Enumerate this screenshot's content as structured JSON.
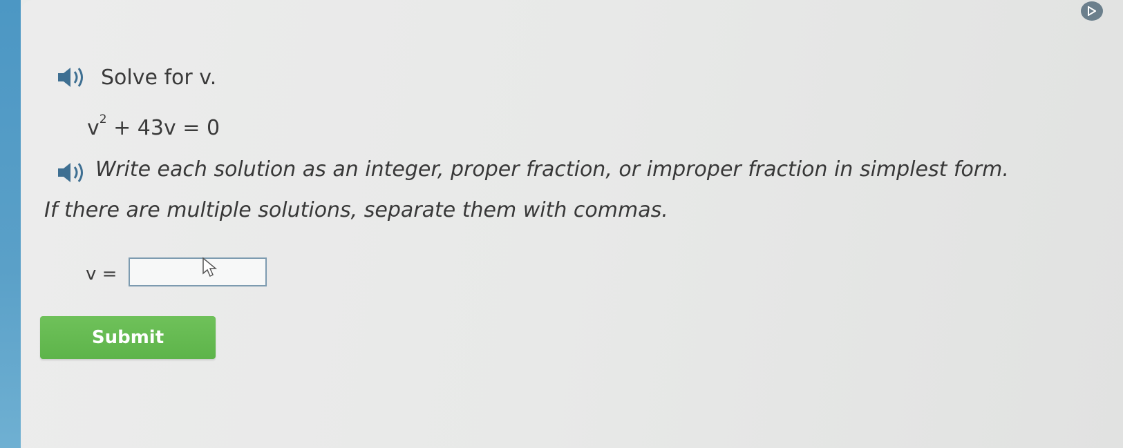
{
  "question": {
    "title": "Solve for v.",
    "equation_base": "v",
    "equation_exponent": "2",
    "equation_rest": " + 43v = 0"
  },
  "instructions": {
    "line1": "Write each solution as an integer, proper fraction, or improper fraction in simplest form.",
    "line2": "If there are multiple solutions, separate them with commas."
  },
  "answer": {
    "label": "v =",
    "value": ""
  },
  "submit": {
    "label": "Submit"
  },
  "colors": {
    "submit": "#5db44a",
    "accent": "#4c97c4",
    "audio_icon": "#3e6f92"
  },
  "icons": {
    "title_audio": "speaker-icon",
    "instructions_audio": "speaker-icon",
    "corner": "play-icon"
  }
}
